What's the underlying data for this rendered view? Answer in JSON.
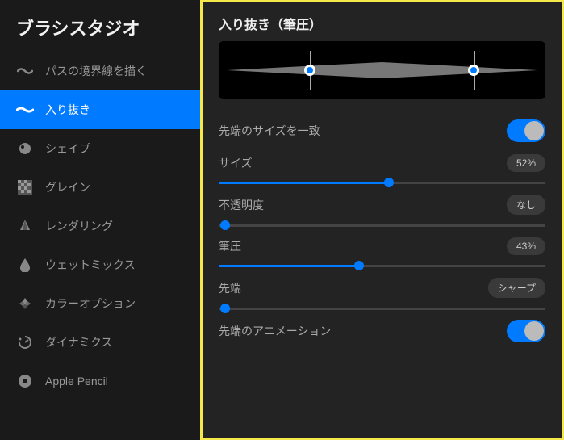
{
  "sidebar": {
    "title": "ブラシスタジオ",
    "items": [
      {
        "label": "パスの境界線を描く",
        "icon": "stroke-path-icon"
      },
      {
        "label": "入り抜き",
        "icon": "taper-icon"
      },
      {
        "label": "シェイプ",
        "icon": "shape-icon"
      },
      {
        "label": "グレイン",
        "icon": "grain-icon"
      },
      {
        "label": "レンダリング",
        "icon": "rendering-icon"
      },
      {
        "label": "ウェットミックス",
        "icon": "wetmix-icon"
      },
      {
        "label": "カラーオプション",
        "icon": "color-options-icon"
      },
      {
        "label": "ダイナミクス",
        "icon": "dynamics-icon"
      },
      {
        "label": "Apple Pencil",
        "icon": "apple-pencil-icon"
      }
    ],
    "active_index": 1
  },
  "panel": {
    "title": "入り抜き（筆圧）",
    "preview": {
      "node1_pct": 28,
      "node2_pct": 78
    },
    "match_tip": {
      "label": "先端のサイズを一致",
      "on": true
    },
    "sliders": [
      {
        "id": "size",
        "label": "サイズ",
        "value_text": "52%",
        "pct": 52
      },
      {
        "id": "opacity",
        "label": "不透明度",
        "value_text": "なし",
        "pct": 0
      },
      {
        "id": "pressure",
        "label": "筆圧",
        "value_text": "43%",
        "pct": 43
      },
      {
        "id": "tip",
        "label": "先端",
        "value_text": "シャープ",
        "pct": 0
      }
    ],
    "tip_anim": {
      "label": "先端のアニメーション",
      "on": true
    }
  },
  "colors": {
    "accent": "#007aff",
    "highlight_border": "#f5e84a"
  }
}
